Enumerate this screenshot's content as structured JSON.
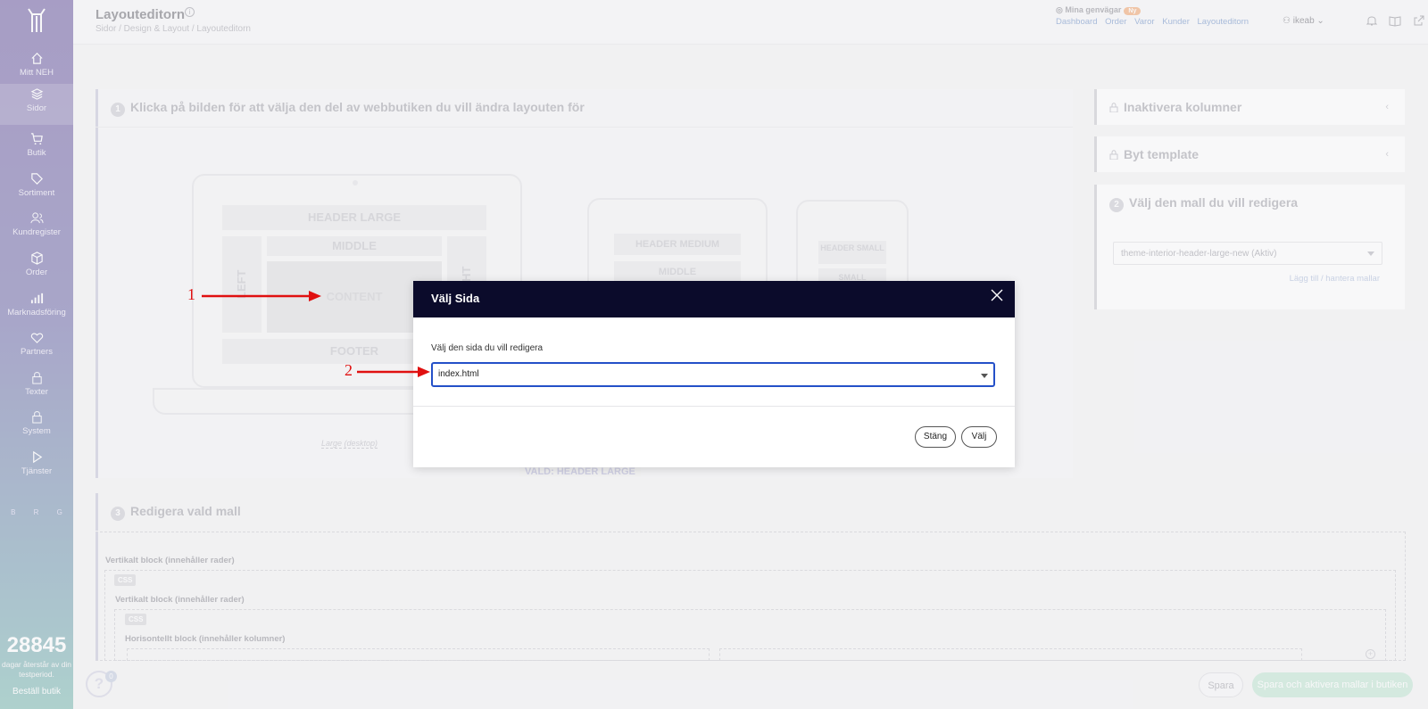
{
  "sidebar": {
    "items": [
      {
        "label": "Mitt NEH",
        "icon": "home-icon"
      },
      {
        "label": "Sidor",
        "icon": "layers-icon"
      },
      {
        "label": "Butik",
        "icon": "cart-icon"
      },
      {
        "label": "Sortiment",
        "icon": "tag-icon"
      },
      {
        "label": "Kundregister",
        "icon": "users-icon"
      },
      {
        "label": "Order",
        "icon": "box-icon"
      },
      {
        "label": "Marknadsföring",
        "icon": "bar-chart-icon"
      },
      {
        "label": "Partners",
        "icon": "heart-icon"
      },
      {
        "label": "Texter",
        "icon": "lock-icon"
      },
      {
        "label": "System",
        "icon": "lock-icon"
      },
      {
        "label": "Tjänster",
        "icon": "play-icon"
      }
    ],
    "brg": "B R G",
    "trial_days": "28845",
    "trial_text": "dagar återstår av din testperiod.",
    "trial_link": "Beställ butik"
  },
  "header": {
    "title": "Layouteditorn",
    "breadcrumb": "Sidor / Design & Layout / Layouteditorn",
    "shortcuts_title": "Mina genvägar",
    "shortcuts_badge": "Ny",
    "shortcuts": [
      "Dashboard",
      "Order",
      "Varor",
      "Kunder",
      "Layouteditorn"
    ],
    "user": "ikeab"
  },
  "step1": {
    "num": "1",
    "title": "Klicka på bilden för att välja den del av webbutiken du vill ändra layouten för",
    "areas": {
      "header_large": "HEADER LARGE",
      "middle": "MIDDLE",
      "left": "LEFT",
      "right": "RIGHT",
      "content": "CONTENT",
      "footer": "FOOTER",
      "header_medium": "HEADER MEDIUM",
      "middle2": "MIDDLE",
      "header_small": "HEADER SMALL",
      "small2": "SMALL"
    },
    "device_label": "Large (desktop)"
  },
  "vald": "VALD: HEADER LARGE",
  "right_panels": {
    "inaktivera": "Inaktivera kolumner",
    "byt": "Byt template",
    "step2_num": "2",
    "step2_title": "Välj den mall du vill redigera",
    "template_value": "theme-interior-header-large-new (Aktiv)",
    "manage_link": "Lägg till / hantera mallar"
  },
  "step3": {
    "num": "3",
    "title": "Redigera vald mall",
    "block1": "Vertikalt block (innehåller rader)",
    "block2": "Vertikalt block (innehåller rader)",
    "block3": "Horisontellt block (innehåller kolumner)",
    "css": "CSS"
  },
  "bottom": {
    "save": "Spara",
    "save_activate": "Spara och aktivera mallar i butiken",
    "help_badge": "0"
  },
  "modal": {
    "title": "Välj Sida",
    "label": "Välj den sida du vill redigera",
    "selected": "index.html",
    "close_btn": "Stäng",
    "select_btn": "Välj"
  },
  "annotations": {
    "one": "1",
    "two": "2"
  },
  "colors": {
    "modal_header": "#0b0b2b",
    "select_border": "#2450c8",
    "annotation": "#e01010"
  }
}
